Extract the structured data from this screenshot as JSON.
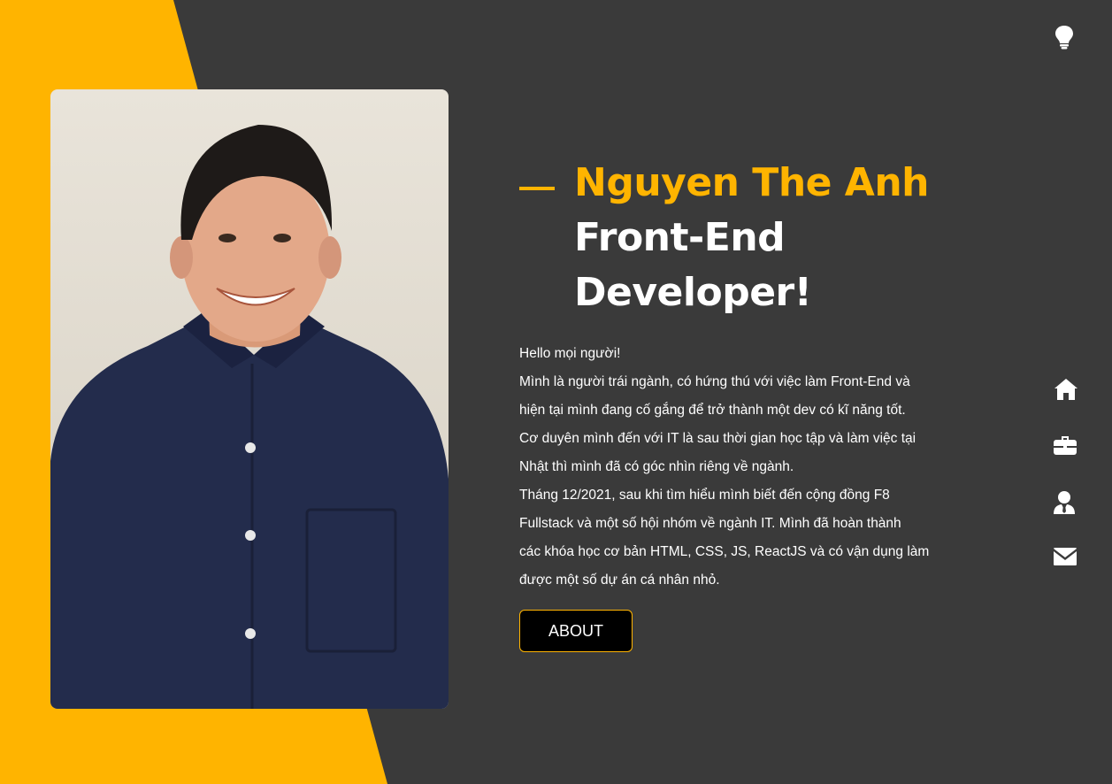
{
  "header": {
    "name": "Nguyen The Anh",
    "role_line1": "Front-End",
    "role_line2": "Developer!"
  },
  "intro": {
    "lines": [
      "Hello mọi người!",
      "Mình là người trái ngành, có hứng thú với việc làm Front-End và",
      "hiện tại mình đang cố gắng để trở thành một dev có kĩ năng tốt.",
      "Cơ duyên mình đến với IT là sau thời gian học tập và làm việc tại",
      "Nhật thì mình đã có góc nhìn riêng về ngành.",
      "Tháng 12/2021, sau khi tìm hiểu mình biết đến cộng đồng F8",
      "Fullstack và một số hội nhóm về ngành IT. Mình đã hoàn thành",
      "các khóa học cơ bản HTML, CSS, JS, ReactJS và có vận dụng làm",
      "được một số dự án cá nhân nhỏ."
    ]
  },
  "buttons": {
    "about": "ABOUT"
  },
  "icons": {
    "theme_toggle": "lightbulb-icon",
    "nav": [
      "home-icon",
      "briefcase-icon",
      "user-tie-icon",
      "envelope-icon"
    ]
  },
  "colors": {
    "accent": "#ffb400",
    "background": "#3a3a3a",
    "text": "#ffffff"
  }
}
